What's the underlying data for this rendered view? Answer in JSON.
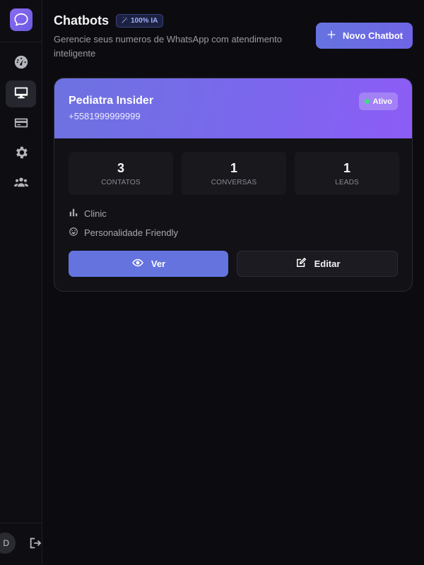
{
  "header": {
    "title": "Chatbots",
    "badge": "100% IA",
    "subtitle": "Gerencie seus numeros de WhatsApp com atendimento inteligente",
    "new_button": "Novo Chatbot"
  },
  "sidebar": {
    "items": [
      {
        "name": "dashboard",
        "icon": "gauge-icon",
        "active": false
      },
      {
        "name": "chatbots",
        "icon": "monitor-icon",
        "active": true
      },
      {
        "name": "billing",
        "icon": "credit-card-icon",
        "active": false
      },
      {
        "name": "settings",
        "icon": "gear-icon",
        "active": false
      },
      {
        "name": "team",
        "icon": "users-icon",
        "active": false
      }
    ],
    "avatar_initial": "D",
    "logout_icon": "logout-icon"
  },
  "card": {
    "name": "Pediatra Insider",
    "phone": "+5581999999999",
    "status": "Ativo",
    "stats": [
      {
        "value": "3",
        "label": "CONTATOS"
      },
      {
        "value": "1",
        "label": "CONVERSAS"
      },
      {
        "value": "1",
        "label": "LEADS"
      }
    ],
    "category": "Clinic",
    "personality": "Personalidade Friendly",
    "view_button": "Ver",
    "edit_button": "Editar"
  },
  "colors": {
    "accent": "#6673df",
    "header_gradient_end": "#8d5cf6",
    "status_dot": "#3ddc84",
    "background": "#0c0c10"
  }
}
